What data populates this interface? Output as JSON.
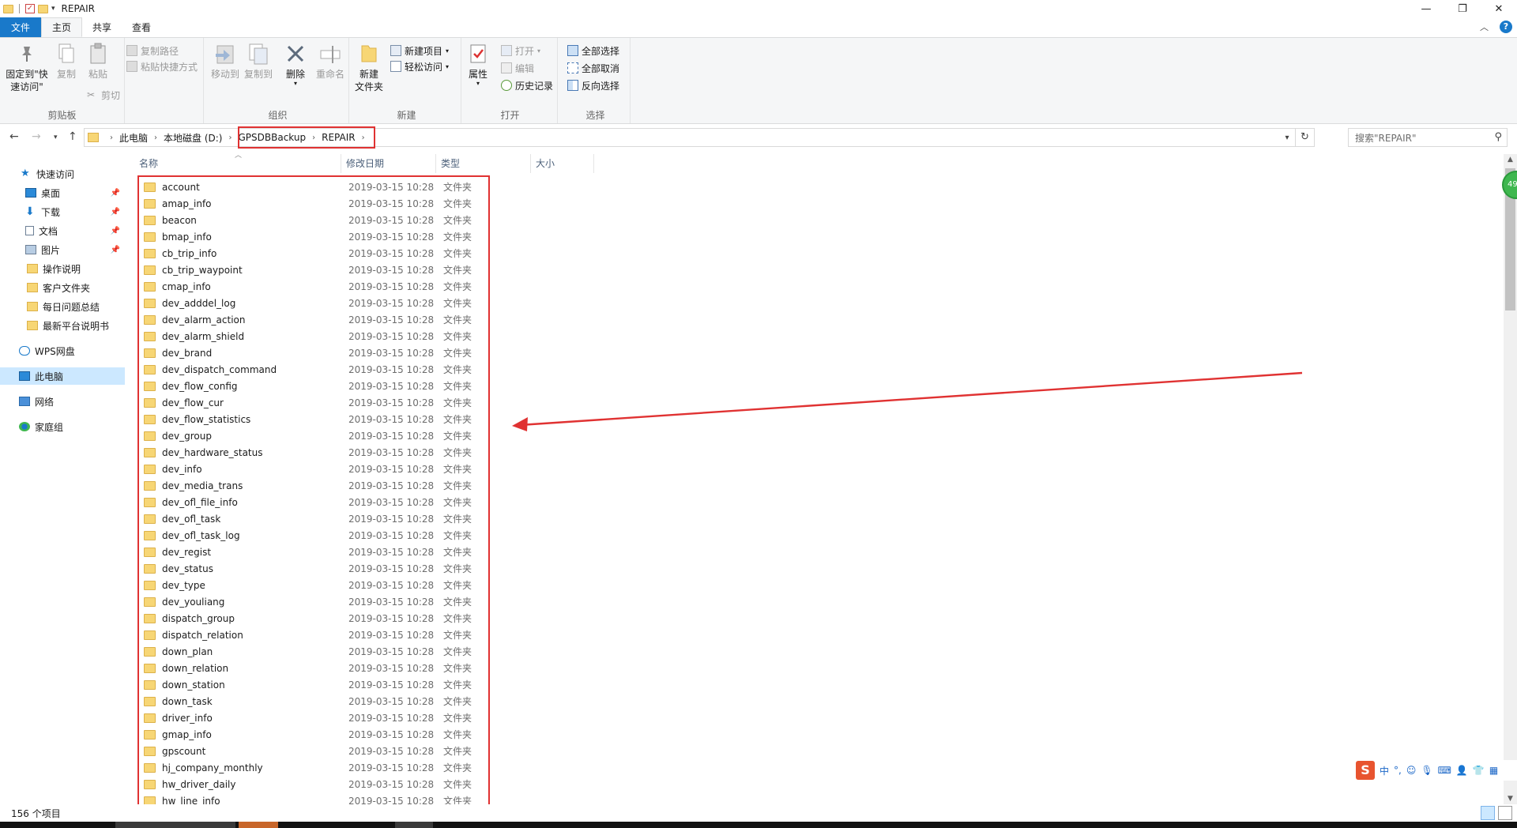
{
  "window": {
    "title": "REPAIR",
    "controls": {
      "minimize": "—",
      "restore": "❐",
      "close": "✕"
    }
  },
  "ribbon_tabs": [
    "文件",
    "主页",
    "共享",
    "查看"
  ],
  "ribbon": {
    "clipboard": {
      "label": "剪贴板",
      "pin": "固定到\"快\n速访问\"",
      "copy": "复制",
      "paste": "粘贴",
      "copy_path": "复制路径",
      "paste_shortcut": "粘贴快捷方式",
      "cut": "剪切"
    },
    "organize": {
      "label": "组织",
      "move_to": "移动到",
      "copy_to": "复制到",
      "delete": "删除",
      "rename": "重命名"
    },
    "new": {
      "label": "新建",
      "new_folder": "新建\n文件夹",
      "new_item": "新建项目",
      "easy_access": "轻松访问"
    },
    "open": {
      "label": "打开",
      "properties": "属性",
      "open": "打开",
      "edit": "编辑",
      "history": "历史记录"
    },
    "select": {
      "label": "选择",
      "select_all": "全部选择",
      "select_none": "全部取消",
      "invert": "反向选择"
    }
  },
  "address": {
    "crumbs": [
      "此电脑",
      "本地磁盘 (D:)",
      "GPSDBBackup",
      "REPAIR"
    ],
    "search_placeholder": "搜索\"REPAIR\""
  },
  "nav_pane": [
    {
      "label": "快速访问",
      "icon": "star-icon",
      "pinned": false
    },
    {
      "label": "桌面",
      "icon": "desktop-icon",
      "pinned": true
    },
    {
      "label": "下载",
      "icon": "download-icon",
      "pinned": true
    },
    {
      "label": "文档",
      "icon": "document-icon",
      "pinned": true
    },
    {
      "label": "图片",
      "icon": "picture-icon",
      "pinned": true
    },
    {
      "label": "操作说明",
      "icon": "folder-icon",
      "pinned": false
    },
    {
      "label": "客户文件夹",
      "icon": "folder-icon",
      "pinned": false
    },
    {
      "label": "每日问题总结",
      "icon": "folder-icon",
      "pinned": false
    },
    {
      "label": "最新平台说明书",
      "icon": "folder-icon",
      "pinned": false
    },
    {
      "label": "WPS网盘",
      "icon": "cloud-icon",
      "pinned": false
    },
    {
      "label": "此电脑",
      "icon": "computer-icon",
      "pinned": false,
      "selected": true
    },
    {
      "label": "网络",
      "icon": "network-icon",
      "pinned": false
    },
    {
      "label": "家庭组",
      "icon": "homegroup-icon",
      "pinned": false
    }
  ],
  "columns": [
    "名称",
    "修改日期",
    "类型",
    "大小"
  ],
  "files": [
    {
      "name": "account",
      "date": "2019-03-15 10:28",
      "type": "文件夹"
    },
    {
      "name": "amap_info",
      "date": "2019-03-15 10:28",
      "type": "文件夹"
    },
    {
      "name": "beacon",
      "date": "2019-03-15 10:28",
      "type": "文件夹"
    },
    {
      "name": "bmap_info",
      "date": "2019-03-15 10:28",
      "type": "文件夹"
    },
    {
      "name": "cb_trip_info",
      "date": "2019-03-15 10:28",
      "type": "文件夹"
    },
    {
      "name": "cb_trip_waypoint",
      "date": "2019-03-15 10:28",
      "type": "文件夹"
    },
    {
      "name": "cmap_info",
      "date": "2019-03-15 10:28",
      "type": "文件夹"
    },
    {
      "name": "dev_adddel_log",
      "date": "2019-03-15 10:28",
      "type": "文件夹"
    },
    {
      "name": "dev_alarm_action",
      "date": "2019-03-15 10:28",
      "type": "文件夹"
    },
    {
      "name": "dev_alarm_shield",
      "date": "2019-03-15 10:28",
      "type": "文件夹"
    },
    {
      "name": "dev_brand",
      "date": "2019-03-15 10:28",
      "type": "文件夹"
    },
    {
      "name": "dev_dispatch_command",
      "date": "2019-03-15 10:28",
      "type": "文件夹"
    },
    {
      "name": "dev_flow_config",
      "date": "2019-03-15 10:28",
      "type": "文件夹"
    },
    {
      "name": "dev_flow_cur",
      "date": "2019-03-15 10:28",
      "type": "文件夹"
    },
    {
      "name": "dev_flow_statistics",
      "date": "2019-03-15 10:28",
      "type": "文件夹"
    },
    {
      "name": "dev_group",
      "date": "2019-03-15 10:28",
      "type": "文件夹"
    },
    {
      "name": "dev_hardware_status",
      "date": "2019-03-15 10:28",
      "type": "文件夹"
    },
    {
      "name": "dev_info",
      "date": "2019-03-15 10:28",
      "type": "文件夹"
    },
    {
      "name": "dev_media_trans",
      "date": "2019-03-15 10:28",
      "type": "文件夹"
    },
    {
      "name": "dev_ofl_file_info",
      "date": "2019-03-15 10:28",
      "type": "文件夹"
    },
    {
      "name": "dev_ofl_task",
      "date": "2019-03-15 10:28",
      "type": "文件夹"
    },
    {
      "name": "dev_ofl_task_log",
      "date": "2019-03-15 10:28",
      "type": "文件夹"
    },
    {
      "name": "dev_regist",
      "date": "2019-03-15 10:28",
      "type": "文件夹"
    },
    {
      "name": "dev_status",
      "date": "2019-03-15 10:28",
      "type": "文件夹"
    },
    {
      "name": "dev_type",
      "date": "2019-03-15 10:28",
      "type": "文件夹"
    },
    {
      "name": "dev_youliang",
      "date": "2019-03-15 10:28",
      "type": "文件夹"
    },
    {
      "name": "dispatch_group",
      "date": "2019-03-15 10:28",
      "type": "文件夹"
    },
    {
      "name": "dispatch_relation",
      "date": "2019-03-15 10:28",
      "type": "文件夹"
    },
    {
      "name": "down_plan",
      "date": "2019-03-15 10:28",
      "type": "文件夹"
    },
    {
      "name": "down_relation",
      "date": "2019-03-15 10:28",
      "type": "文件夹"
    },
    {
      "name": "down_station",
      "date": "2019-03-15 10:28",
      "type": "文件夹"
    },
    {
      "name": "down_task",
      "date": "2019-03-15 10:28",
      "type": "文件夹"
    },
    {
      "name": "driver_info",
      "date": "2019-03-15 10:28",
      "type": "文件夹"
    },
    {
      "name": "gmap_info",
      "date": "2019-03-15 10:28",
      "type": "文件夹"
    },
    {
      "name": "gpscount",
      "date": "2019-03-15 10:28",
      "type": "文件夹"
    },
    {
      "name": "hj_company_monthly",
      "date": "2019-03-15 10:28",
      "type": "文件夹"
    },
    {
      "name": "hw_driver_daily",
      "date": "2019-03-15 10:28",
      "type": "文件夹"
    },
    {
      "name": "hw_line_info",
      "date": "2019-03-15 10:28",
      "type": "文件夹"
    }
  ],
  "status": {
    "item_count": "156 个项目"
  },
  "float_badge": "49",
  "ime": {
    "logo": "S",
    "mode": "中",
    "punct": "°,"
  },
  "colors": {
    "accent": "#1979ca",
    "highlight": "#e03232",
    "folder": "#f7d675"
  }
}
